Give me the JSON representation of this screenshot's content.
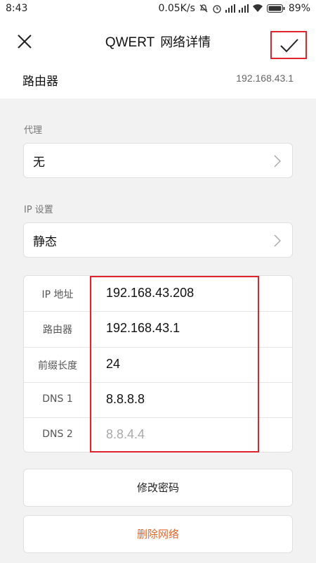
{
  "status_bar": {
    "time": "8:43",
    "speed": "0.05K/s",
    "battery": "89%"
  },
  "header": {
    "ssid": "QWERT",
    "title": "网络详情",
    "close_icon": "close-icon",
    "confirm_icon": "checkmark-icon"
  },
  "router": {
    "label": "路由器",
    "value": "192.168.43.1"
  },
  "proxy": {
    "section_label": "代理",
    "value": "无"
  },
  "ip_settings": {
    "section_label": "IP 设置",
    "value": "静态"
  },
  "static_ip": {
    "rows": [
      {
        "label": "IP 地址",
        "value": "192.168.43.208"
      },
      {
        "label": "路由器",
        "value": "192.168.43.1"
      },
      {
        "label": "前缀长度",
        "value": "24"
      },
      {
        "label": "DNS 1",
        "value": "8.8.8.8"
      },
      {
        "label": "DNS 2",
        "placeholder": "8.8.4.4"
      }
    ]
  },
  "actions": {
    "modify_password": "修改密码",
    "delete_network": "删除网络"
  },
  "colors": {
    "highlight_box": "#e0242c",
    "danger_text": "#e8642a",
    "background": "#f2f2f2"
  }
}
